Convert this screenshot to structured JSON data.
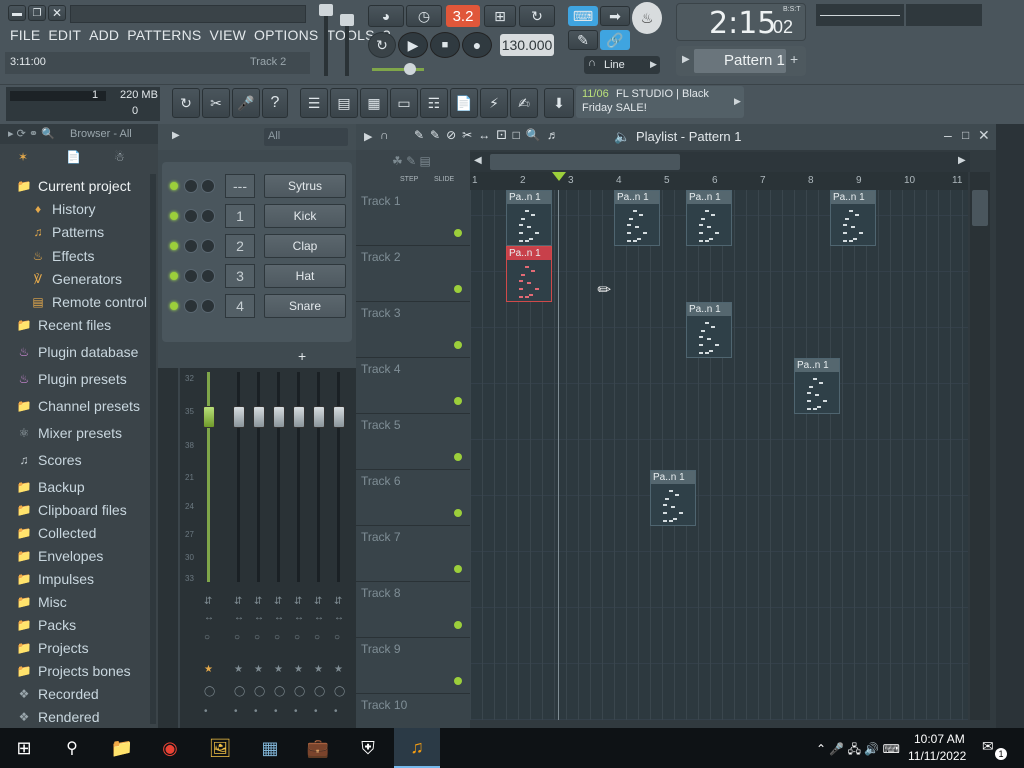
{
  "window": {
    "title_buttons": [
      "minimize",
      "restore",
      "close"
    ]
  },
  "menu": [
    "FILE",
    "EDIT",
    "ADD",
    "PATTERNS",
    "VIEW",
    "OPTIONS",
    "TOOLS",
    "?"
  ],
  "hint": {
    "time": "3:11:00",
    "track": "Track 2"
  },
  "transport": {
    "tempo": "130.000",
    "pattern_mode": "3.2",
    "snap": "Line"
  },
  "clock": {
    "main": "2:15",
    "sub": "02",
    "unit": "B:S:T"
  },
  "pattern_selector": {
    "label": "Pattern 1"
  },
  "cpu": {
    "value": "1",
    "memory": "220 MB",
    "poly": "0"
  },
  "news": {
    "date": "11/06",
    "line1": "FL STUDIO | Black",
    "line2": "Friday SALE!"
  },
  "browser": {
    "header": "Browser - All",
    "items": [
      {
        "label": "Current project",
        "icon": "folder-icon",
        "indent": 0
      },
      {
        "label": "History",
        "icon": "history-icon",
        "indent": 1
      },
      {
        "label": "Patterns",
        "icon": "note-icon",
        "indent": 1
      },
      {
        "label": "Effects",
        "icon": "plugin-icon",
        "indent": 1
      },
      {
        "label": "Generators",
        "icon": "generator-icon",
        "indent": 1
      },
      {
        "label": "Remote control",
        "icon": "remote-icon",
        "indent": 1
      },
      {
        "label": "Recent files",
        "icon": "folder-icon",
        "indent": 0
      },
      {
        "label": "Plugin database",
        "icon": "plugin-icon",
        "indent": 0
      },
      {
        "label": "Plugin presets",
        "icon": "plugin-icon",
        "indent": 0
      },
      {
        "label": "Channel presets",
        "icon": "folder-icon",
        "indent": 0
      },
      {
        "label": "Mixer presets",
        "icon": "mixer-icon",
        "indent": 0
      },
      {
        "label": "Scores",
        "icon": "note-icon",
        "indent": 0
      },
      {
        "label": "Backup",
        "icon": "folder-icon",
        "indent": 0
      },
      {
        "label": "Clipboard files",
        "icon": "folder-icon",
        "indent": 0
      },
      {
        "label": "Collected",
        "icon": "folder-icon",
        "indent": 0
      },
      {
        "label": "Envelopes",
        "icon": "folder-icon",
        "indent": 0
      },
      {
        "label": "Impulses",
        "icon": "folder-icon",
        "indent": 0
      },
      {
        "label": "Misc",
        "icon": "folder-icon",
        "indent": 0
      },
      {
        "label": "Packs",
        "icon": "folder-icon",
        "indent": 0
      },
      {
        "label": "Projects",
        "icon": "folder-icon",
        "indent": 0
      },
      {
        "label": "Projects bones",
        "icon": "folder-icon",
        "indent": 0
      },
      {
        "label": "Recorded",
        "icon": "recorded-icon",
        "indent": 0
      },
      {
        "label": "Rendered",
        "icon": "recorded-icon",
        "indent": 0
      }
    ]
  },
  "rack": {
    "filter": "All",
    "channels": [
      {
        "num": "---",
        "name": "Sytrus"
      },
      {
        "num": "1",
        "name": "Kick"
      },
      {
        "num": "2",
        "name": "Clap"
      },
      {
        "num": "3",
        "name": "Hat"
      },
      {
        "num": "4",
        "name": "Snare"
      }
    ],
    "add_label": "+"
  },
  "mixer": {
    "db_marks": [
      "32",
      "35",
      "38",
      "21",
      "24",
      "27",
      "30",
      "33"
    ]
  },
  "playlist": {
    "title": "Playlist - Pattern 1",
    "step_label": "STEP",
    "slide_label": "SLIDE",
    "bars": [
      "1",
      "2",
      "3",
      "4",
      "5",
      "6",
      "7",
      "8",
      "9",
      "10",
      "11"
    ],
    "tracks": [
      "Track 1",
      "Track 2",
      "Track 3",
      "Track 4",
      "Track 5",
      "Track 6",
      "Track 7",
      "Track 8",
      "Track 9",
      "Track 10"
    ],
    "clip_label": "Pa..n 1"
  },
  "taskbar": {
    "time": "10:07 AM",
    "date": "11/11/2022",
    "notifications": "1"
  }
}
